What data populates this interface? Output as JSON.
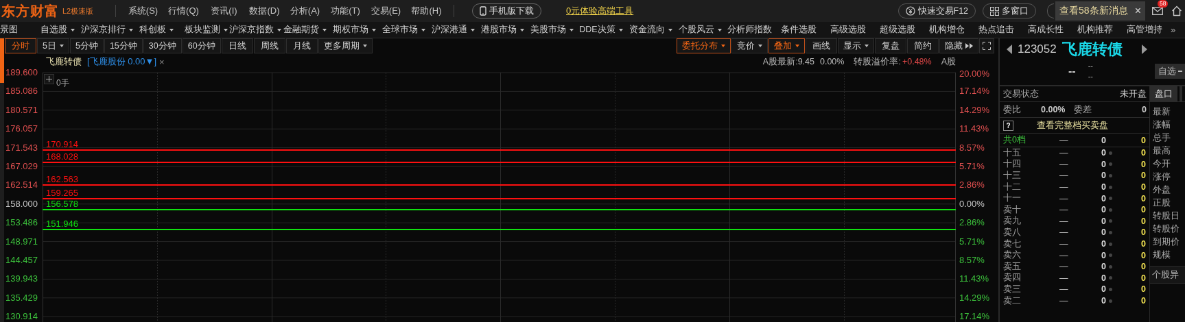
{
  "app_bar": {
    "logo": "东方财富",
    "edition": "L2极速版",
    "menus": [
      "系统(S)",
      "行情(Q)",
      "资讯(I)",
      "数据(D)",
      "分析(A)",
      "功能(T)",
      "交易(E)",
      "帮助(H)"
    ],
    "mobile_button": "手机版下载",
    "promo_link": "0元体验高端工具",
    "quick_trade_button": "快速交易F12",
    "multi_window_button": "多窗口",
    "notification": {
      "text": "查看58条新消息",
      "close": "×"
    },
    "mail_badge": "58"
  },
  "nav_bar": {
    "items": [
      {
        "label": "景图",
        "has_menu": false
      },
      {
        "label": "自选股",
        "has_menu": true
      },
      {
        "label": "沪深京排行",
        "has_menu": true
      },
      {
        "label": "科创板",
        "has_menu": true
      },
      {
        "label": "板块监测",
        "has_menu": true
      },
      {
        "label": "沪深京指数",
        "has_menu": true
      },
      {
        "label": "金融期货",
        "has_menu": true
      },
      {
        "label": "期权市场",
        "has_menu": true
      },
      {
        "label": "全球市场",
        "has_menu": true
      },
      {
        "label": "沪深港通",
        "has_menu": true
      },
      {
        "label": "港股市场",
        "has_menu": true
      },
      {
        "label": "美股市场",
        "has_menu": true
      },
      {
        "label": "DDE决策",
        "has_menu": true
      },
      {
        "label": "资金流向",
        "has_menu": true
      },
      {
        "label": "个股风云",
        "has_menu": true
      },
      {
        "label": "分析师指数",
        "has_menu": false
      },
      {
        "label": "条件选股",
        "has_menu": false
      },
      {
        "label": "高级选股",
        "has_menu": false
      },
      {
        "label": "超级选股",
        "has_menu": false
      },
      {
        "label": "机构增仓",
        "has_menu": false
      },
      {
        "label": "热点追击",
        "has_menu": false
      },
      {
        "label": "高成长性",
        "has_menu": false
      },
      {
        "label": "机构推荐",
        "has_menu": false
      },
      {
        "label": "高管增持",
        "has_menu": false
      }
    ],
    "more": "»"
  },
  "period_tabs": [
    {
      "label": "分时",
      "selected": true,
      "has_menu": false
    },
    {
      "label": "5日",
      "selected": false,
      "has_menu": true
    },
    {
      "label": "5分钟",
      "selected": false,
      "has_menu": false
    },
    {
      "label": "15分钟",
      "selected": false,
      "has_menu": false
    },
    {
      "label": "30分钟",
      "selected": false,
      "has_menu": false
    },
    {
      "label": "60分钟",
      "selected": false,
      "has_menu": false
    },
    {
      "label": "日线",
      "selected": false,
      "has_menu": false
    },
    {
      "label": "周线",
      "selected": false,
      "has_menu": false
    },
    {
      "label": "月线",
      "selected": false,
      "has_menu": false
    },
    {
      "label": "更多周期",
      "selected": false,
      "has_menu": true
    }
  ],
  "chart_tools": [
    {
      "label": "委托分布",
      "active": true,
      "kind": "menu"
    },
    {
      "label": "竞价",
      "active": false,
      "kind": "menu"
    },
    {
      "label": "叠加",
      "active": true,
      "kind": "menu"
    },
    {
      "label": "画线",
      "active": false,
      "kind": "plain"
    },
    {
      "label": "显示",
      "active": false,
      "kind": "menu"
    },
    {
      "label": "复盘",
      "active": false,
      "kind": "plain"
    },
    {
      "label": "简约",
      "active": false,
      "kind": "plain"
    },
    {
      "label": "隐藏",
      "active": false,
      "kind": "collapse"
    }
  ],
  "chart": {
    "title": "飞鹿转债",
    "overlay": "[飞鹿股份 0.00▼]",
    "overlay_close": "×",
    "volume": "0手",
    "quote_label": "A股最新:9.45",
    "quote_change": "0.00%",
    "premium_label": "转股溢价率:",
    "premium_value": "+0.48%",
    "quote_tail": "A股",
    "price_ticks": [
      {
        "label": "189.600",
        "color": "#e05050"
      },
      {
        "label": "185.086",
        "color": "#e05050"
      },
      {
        "label": "180.571",
        "color": "#e05050"
      },
      {
        "label": "176.057",
        "color": "#e05050"
      },
      {
        "label": "171.543",
        "color": "#e05050"
      },
      {
        "label": "167.029",
        "color": "#e05050"
      },
      {
        "label": "162.514",
        "color": "#e05050"
      },
      {
        "label": "158.000",
        "color": "#c8c8c8"
      },
      {
        "label": "153.486",
        "color": "#3cc03c"
      },
      {
        "label": "148.971",
        "color": "#3cc03c"
      },
      {
        "label": "144.457",
        "color": "#3cc03c"
      },
      {
        "label": "139.943",
        "color": "#3cc03c"
      },
      {
        "label": "135.429",
        "color": "#3cc03c"
      },
      {
        "label": "130.914",
        "color": "#3cc03c"
      }
    ],
    "percent_ticks": [
      {
        "label": "20.00%",
        "color": "#e05050"
      },
      {
        "label": "17.14%",
        "color": "#e05050"
      },
      {
        "label": "14.29%",
        "color": "#e05050"
      },
      {
        "label": "11.43%",
        "color": "#e05050"
      },
      {
        "label": "8.57%",
        "color": "#e05050"
      },
      {
        "label": "5.71%",
        "color": "#e05050"
      },
      {
        "label": "2.86%",
        "color": "#e05050"
      },
      {
        "label": "0.00%",
        "color": "#c8c8c8"
      },
      {
        "label": "2.86%",
        "color": "#3cc03c"
      },
      {
        "label": "5.71%",
        "color": "#3cc03c"
      },
      {
        "label": "8.57%",
        "color": "#3cc03c"
      },
      {
        "label": "11.43%",
        "color": "#3cc03c"
      },
      {
        "label": "14.29%",
        "color": "#3cc03c"
      },
      {
        "label": "17.14%",
        "color": "#3cc03c"
      }
    ],
    "levels": [
      {
        "value": "170.914",
        "color": "#ff1010"
      },
      {
        "value": "168.028",
        "color": "#ff1010"
      },
      {
        "value": "162.563",
        "color": "#ff1010"
      },
      {
        "value": "159.265",
        "color": "#ff1010"
      },
      {
        "value": "156.578",
        "color": "#10e010"
      },
      {
        "value": "151.946",
        "color": "#10e010"
      }
    ]
  },
  "quote_panel": {
    "code": "123052",
    "name": "飞鹿转债",
    "price": "--",
    "change": "--",
    "change_pct": "--",
    "watch_button": "自选",
    "status_label": "交易状态",
    "status_value": "未开盘",
    "ratio_label": "委比",
    "ratio_value": "0.00%",
    "diff_label": "委差",
    "diff_value": "0",
    "help": "?",
    "full_book_link": "查看完整档买卖盘",
    "summary": {
      "label": "共0档",
      "price": "—",
      "volume": "0",
      "count": "0"
    },
    "book": [
      {
        "label": "十五",
        "price": "—",
        "volume": "0",
        "count": "0"
      },
      {
        "label": "十四",
        "price": "—",
        "volume": "0",
        "count": "0"
      },
      {
        "label": "十三",
        "price": "—",
        "volume": "0",
        "count": "0"
      },
      {
        "label": "十二",
        "price": "—",
        "volume": "0",
        "count": "0"
      },
      {
        "label": "十一",
        "price": "—",
        "volume": "0",
        "count": "0"
      },
      {
        "label": "卖十",
        "price": "—",
        "volume": "0",
        "count": "0"
      },
      {
        "label": "卖九",
        "price": "—",
        "volume": "0",
        "count": "0"
      },
      {
        "label": "卖八",
        "price": "—",
        "volume": "0",
        "count": "0"
      },
      {
        "label": "卖七",
        "price": "—",
        "volume": "0",
        "count": "0"
      },
      {
        "label": "卖六",
        "price": "—",
        "volume": "0",
        "count": "0"
      },
      {
        "label": "卖五",
        "price": "—",
        "volume": "0",
        "count": "0"
      },
      {
        "label": "卖四",
        "price": "—",
        "volume": "0",
        "count": "0"
      },
      {
        "label": "卖三",
        "price": "—",
        "volume": "0",
        "count": "0"
      },
      {
        "label": "卖二",
        "price": "—",
        "volume": "0",
        "count": "0"
      }
    ],
    "side_tabs": [
      {
        "label": "盘口",
        "selected": true
      }
    ],
    "fields": [
      "最新",
      "涨幅",
      "总手",
      "最高",
      "今开",
      "涨停",
      "外盘",
      "正股",
      "转股日",
      "转股价",
      "到期价",
      "规模"
    ],
    "alert_header": "个股异"
  }
}
